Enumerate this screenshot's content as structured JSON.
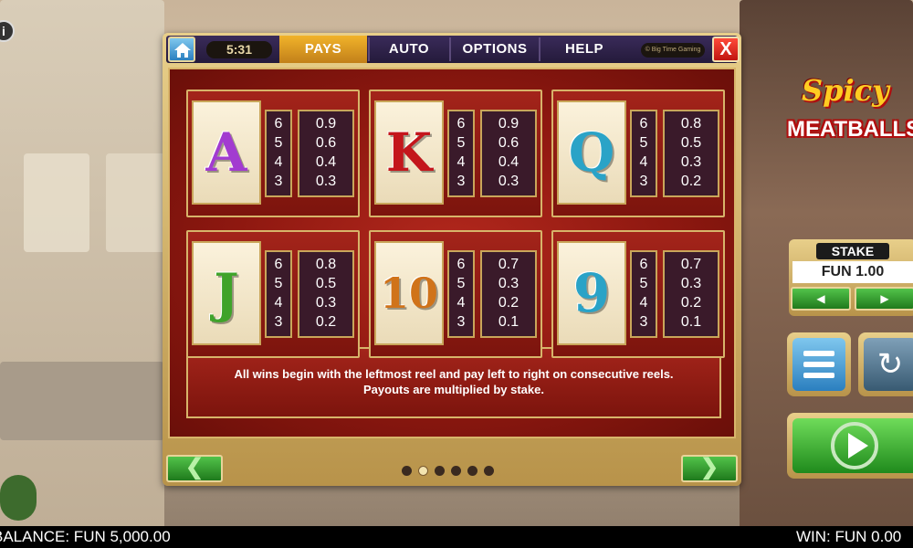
{
  "dialog": {
    "clock": "5:31",
    "tabs": [
      "PAYS",
      "AUTO",
      "OPTIONS",
      "HELP"
    ],
    "active_tab": "PAYS",
    "brand": "© Big Time Gaming",
    "close_label": "X"
  },
  "paytable": [
    {
      "symbol": "A",
      "color": "#a23bd0",
      "counts": [
        "6",
        "5",
        "4",
        "3"
      ],
      "values": [
        "0.9",
        "0.6",
        "0.4",
        "0.3"
      ]
    },
    {
      "symbol": "K",
      "color": "#c4161c",
      "counts": [
        "6",
        "5",
        "4",
        "3"
      ],
      "values": [
        "0.9",
        "0.6",
        "0.4",
        "0.3"
      ]
    },
    {
      "symbol": "Q",
      "color": "#2aa3c7",
      "counts": [
        "6",
        "5",
        "4",
        "3"
      ],
      "values": [
        "0.8",
        "0.5",
        "0.3",
        "0.2"
      ]
    },
    {
      "symbol": "J",
      "color": "#3fa32a",
      "counts": [
        "6",
        "5",
        "4",
        "3"
      ],
      "values": [
        "0.8",
        "0.5",
        "0.3",
        "0.2"
      ]
    },
    {
      "symbol": "10",
      "color": "#d0731a",
      "counts": [
        "6",
        "5",
        "4",
        "3"
      ],
      "values": [
        "0.7",
        "0.3",
        "0.2",
        "0.1"
      ]
    },
    {
      "symbol": "9",
      "color": "#2aa3c7",
      "counts": [
        "6",
        "5",
        "4",
        "3"
      ],
      "values": [
        "0.7",
        "0.3",
        "0.2",
        "0.1"
      ]
    }
  ],
  "description": {
    "line1": "All wins begin with the leftmost reel and pay left to right on consecutive reels.",
    "line2": "Payouts are multiplied by stake."
  },
  "pagination": {
    "total": 6,
    "current": 2
  },
  "logo": {
    "line1": "Spicy",
    "line2": "MEATBALLS"
  },
  "stake": {
    "label": "STAKE",
    "value": "FUN 1.00"
  },
  "status": {
    "balance": "BALANCE: FUN 5,000.00",
    "win": "WIN: FUN 0.00"
  },
  "info_icon": "i"
}
